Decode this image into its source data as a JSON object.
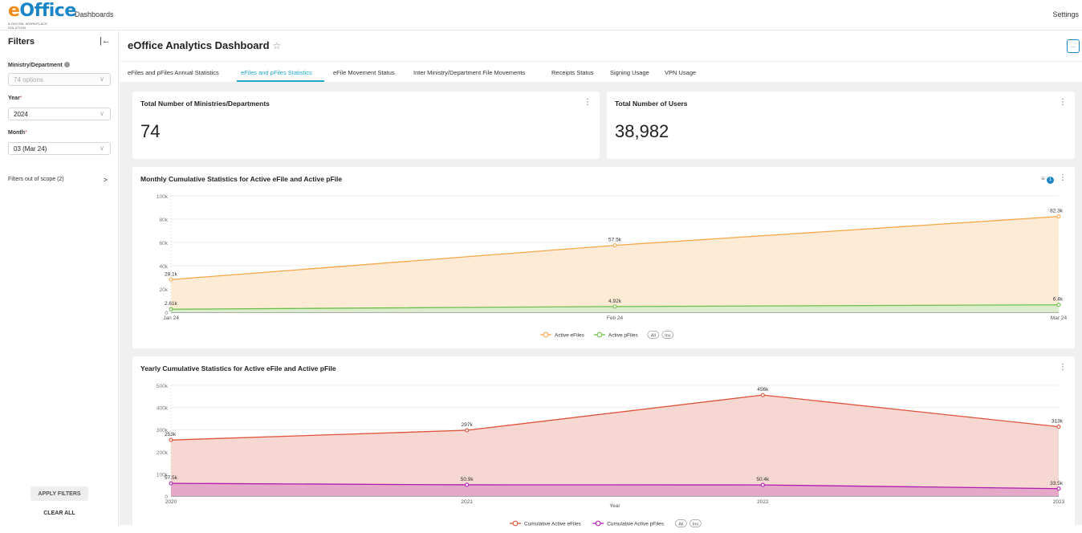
{
  "topbar": {
    "logo_text_e": "e",
    "logo_text_rest": "Office",
    "logo_tagline": "A DIGITAL WORKPLACE SOLUTION",
    "nav_dashboards": "Dashboards",
    "nav_settings": "Settings"
  },
  "filters": {
    "title": "Filters",
    "ministry_label": "Ministry/Department",
    "ministry_placeholder": "74 options",
    "year_label": "Year",
    "year_value": "2024",
    "month_label": "Month",
    "month_value": "03 (Mar 24)",
    "required_mark": "*",
    "scope_text": "Filters out of scope (2)",
    "apply_label": "APPLY FILTERS",
    "clear_label": "CLEAR ALL"
  },
  "dashboard": {
    "title": "eOffice Analytics Dashboard",
    "more_label": "..."
  },
  "tabs": [
    {
      "label": "eFiles and pFiles Annual Statistics"
    },
    {
      "label": "eFiles and pFiles Statistics",
      "active": true
    },
    {
      "label": "eFile Movement Status"
    },
    {
      "label": "Inter Ministry/Department File Movements"
    },
    {
      "label": "Receipts Status"
    },
    {
      "label": "Signing Usage"
    },
    {
      "label": "VPN Usage"
    }
  ],
  "kpis": {
    "ministries": {
      "title": "Total Number of Ministries/Departments",
      "value": "74"
    },
    "users": {
      "title": "Total Number of Users",
      "value": "38,982"
    }
  },
  "colors": {
    "accent": "#20a7c9",
    "efiles_monthly": "#f7a74a",
    "efiles_monthly_fill": "#fde8cf",
    "pfiles_monthly": "#6cc04a",
    "efiles_yearly": "#e0533a",
    "efiles_yearly_fill": "#f5d0c9",
    "pfiles_yearly": "#b01cb0",
    "pfiles_yearly_fill": "#e3a3c7"
  },
  "chart_data": [
    {
      "id": "monthly",
      "type": "area",
      "title": "Monthly Cumulative Statistics for Active eFile and Active pFile",
      "filter_count": "1",
      "categories": [
        "Jan 24",
        "Feb 24",
        "Mar 24"
      ],
      "ylim": [
        0,
        100000
      ],
      "yticks": [
        "0",
        "20k",
        "40k",
        "60k",
        "80k",
        "100k"
      ],
      "ytick_values": [
        0,
        20000,
        40000,
        60000,
        80000,
        100000
      ],
      "xlabel": "",
      "series": [
        {
          "name": "Active eFiles",
          "values": [
            28100,
            57500,
            82300
          ],
          "labels": [
            "28.1k",
            "57.5k",
            "82.3k"
          ],
          "color": "#f7a74a",
          "fill": "#fde8cf"
        },
        {
          "name": "Active pFiles",
          "values": [
            2610,
            4920,
            6400
          ],
          "labels": [
            "2.61k",
            "4.92k",
            "6.4k"
          ],
          "color": "#6cc04a",
          "fill": "#d6eccb"
        }
      ],
      "legend_extra": [
        "All",
        "Inv"
      ],
      "legend_position": "bottom"
    },
    {
      "id": "yearly",
      "type": "area",
      "title": "Yearly Cumulative Statistics for Active eFile and Active pFile",
      "categories": [
        "2020",
        "2021",
        "2022",
        "2023"
      ],
      "ylim": [
        0,
        500000
      ],
      "yticks": [
        "0",
        "100k",
        "200k",
        "300k",
        "400k",
        "500k"
      ],
      "ytick_values": [
        0,
        100000,
        200000,
        300000,
        400000,
        500000
      ],
      "xlabel": "Year",
      "series": [
        {
          "name": "Cumulative Active eFiles",
          "values": [
            253000,
            297000,
            456000,
            313000
          ],
          "labels": [
            "253k",
            "297k",
            "456k",
            "313k"
          ],
          "color": "#e0533a",
          "fill": "#f5d0c9"
        },
        {
          "name": "Cumulative Active pFiles",
          "values": [
            57500,
            50900,
            50400,
            33500
          ],
          "labels": [
            "57.5k",
            "50.9k",
            "50.4k",
            "33.5k"
          ],
          "color": "#b01cb0",
          "fill": "#e3a3c7"
        }
      ],
      "legend_extra": [
        "All",
        "Inv"
      ],
      "legend_position": "bottom"
    }
  ]
}
